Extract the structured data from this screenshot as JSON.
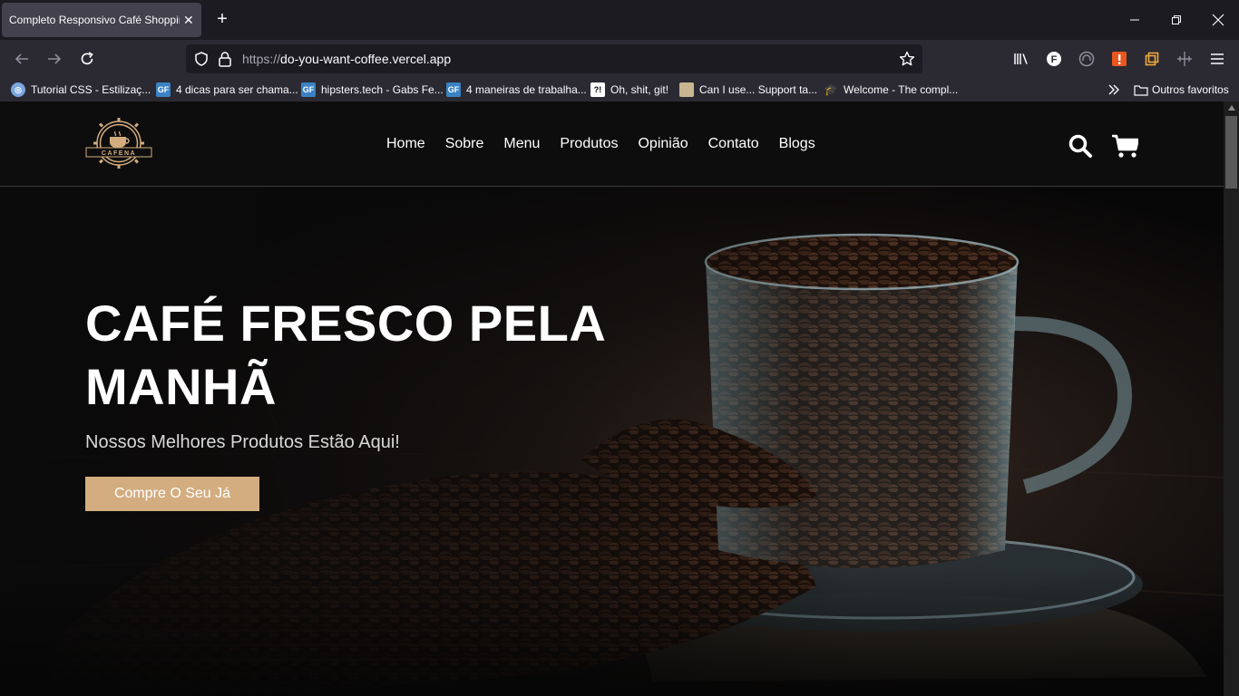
{
  "browser": {
    "tab_title": "Completo Responsivo Café Shopping",
    "url_protocol": "https://",
    "url_host": "do-you-want-coffee.vercel.app",
    "bookmarks": [
      {
        "label": "Tutorial CSS - Estilizaç...",
        "icon": "globe-favicon",
        "color": "#7aa6e0"
      },
      {
        "label": "4 dicas para ser chama...",
        "icon": "gf-favicon",
        "color": "#3b82c4"
      },
      {
        "label": "hipsters.tech - Gabs Fe...",
        "icon": "gf-favicon",
        "color": "#3b82c4"
      },
      {
        "label": "4 maneiras de trabalha...",
        "icon": "gf-favicon",
        "color": "#3b82c4"
      },
      {
        "label": "Oh, shit, git!",
        "icon": "question-favicon",
        "color": "#ffffff"
      },
      {
        "label": "Can I use... Support ta...",
        "icon": "caniuse-favicon",
        "color": "#c9b58f"
      },
      {
        "label": "Welcome - The compl...",
        "icon": "cap-favicon",
        "color": "#2b2a33"
      }
    ],
    "other_bookmarks": "Outros favoritos"
  },
  "site": {
    "logo_text": "CAFENA",
    "nav": [
      "Home",
      "Sobre",
      "Menu",
      "Produtos",
      "Opinião",
      "Contato",
      "Blogs"
    ],
    "hero": {
      "title": "CAFÉ FRESCO PELA MANHÃ",
      "subtitle": "Nossos Melhores Produtos Estão Aqui!",
      "cta": "Compre O Seu Já"
    }
  },
  "colors": {
    "accent": "#d3ad7f",
    "header_bg": "#0e0d0e",
    "chrome_bg": "#2b2a33"
  }
}
